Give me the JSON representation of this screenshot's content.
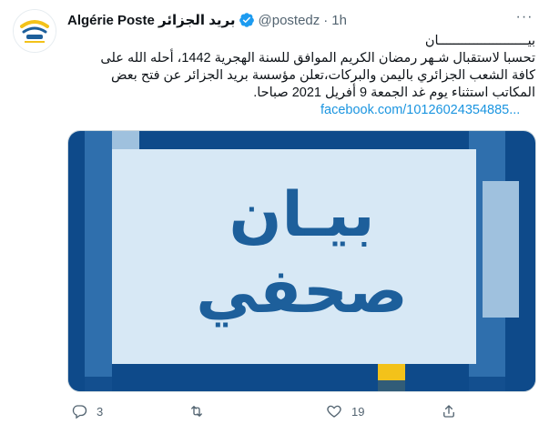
{
  "tweet": {
    "display_name": "Algérie Poste بريد الجزائر",
    "handle": "@postedz",
    "separator": "·",
    "time": "1h",
    "more_label": "···",
    "text_lines": [
      "بيـــــــــــــــــــــــان",
      "تحسبا لاستقبال شـهر رمضان الكريم الموافق للسنة الهجرية 1442، أحله الله على",
      "كافة الشعب الجزائري باليمن والبركات،تعلن مؤسسة بريد الجزائر عن فتح بعض",
      "المكاتب استثناء يوم غد الجمعة 9 أفريل 2021 صباحا."
    ],
    "link_text": "facebook.com/10126024354885...",
    "media": {
      "line1": "بيـان",
      "line2": "صحفي",
      "colors": {
        "dark_blue": "#0e4a8a",
        "mid_blue": "#2f6fad",
        "light_blue": "#9fc1de",
        "panel": "#d7e8f5",
        "text_blue": "#1d5f9b",
        "yellow": "#f3c21a"
      }
    },
    "actions": {
      "reply_count": "3",
      "retweet_count": "",
      "like_count": "19"
    },
    "icons": {
      "avatar": "algerie-poste-logo",
      "verified": "verified-badge-icon",
      "reply": "reply-icon",
      "retweet": "retweet-icon",
      "like": "heart-icon",
      "share": "share-icon"
    },
    "colors": {
      "link": "#1b95e0",
      "secondary": "#536471",
      "verified": "#1d9bf0"
    }
  }
}
